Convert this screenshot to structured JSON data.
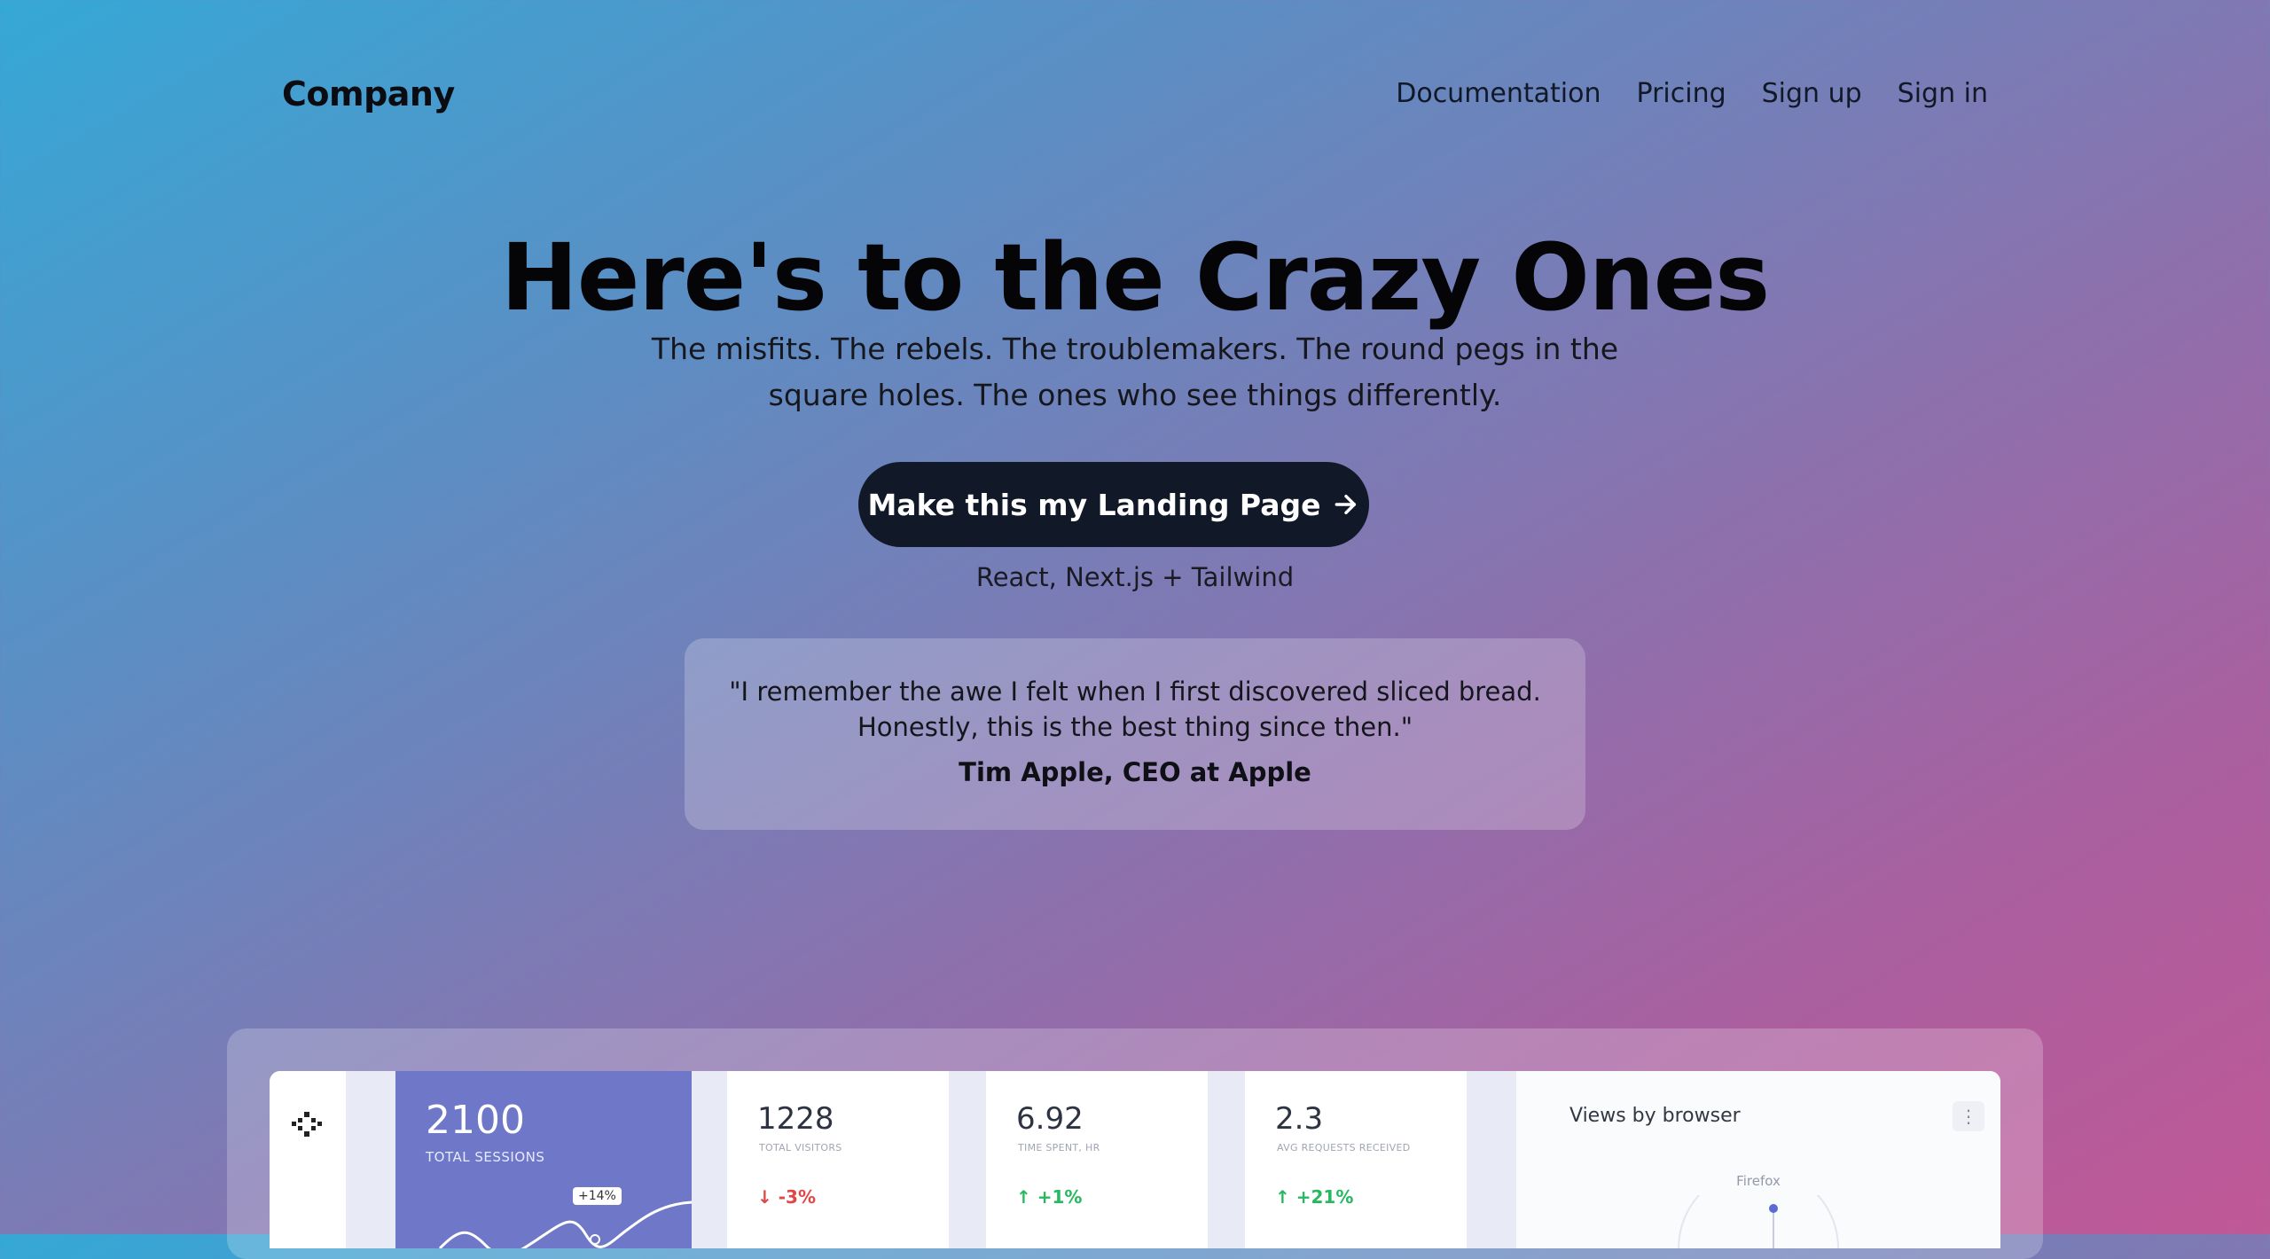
{
  "header": {
    "logo": "Company",
    "nav": [
      "Documentation",
      "Pricing",
      "Sign up",
      "Sign in"
    ]
  },
  "hero": {
    "title": "Here's to the Crazy Ones",
    "subtitle": "The misfits. The rebels. The troublemakers. The round pegs in the square holes. The ones who see things differently.",
    "cta_label": "Make this my Landing Page",
    "stack": "React, Next.js + Tailwind"
  },
  "testimonial": {
    "quote": "\"I remember the awe I felt when I first discovered sliced bread. Honestly, this is the best thing since then.\"",
    "author": "Tim Apple, CEO at Apple"
  },
  "dashboard": {
    "sessions": {
      "value": "2100",
      "label": "TOTAL SESSIONS",
      "badge": "+14%"
    },
    "stats": [
      {
        "value": "1228",
        "label": "TOTAL VISITORS",
        "change": "-3%",
        "direction": "down",
        "arrow": "↓"
      },
      {
        "value": "6.92",
        "label": "TIME SPENT, HR",
        "change": "+1%",
        "direction": "up",
        "arrow": "↑"
      },
      {
        "value": "2.3",
        "label": "AVG REQUESTS RECEIVED",
        "change": "+21%",
        "direction": "up",
        "arrow": "↑"
      }
    ],
    "browser": {
      "title": "Views by browser",
      "visible_label": "Firefox"
    }
  },
  "colors": {
    "cta_bg": "#111827",
    "sessions_card": "#6f78c8",
    "down": "#e04848",
    "up": "#28b860"
  },
  "icons": [
    "arrow-right-icon",
    "dashboard-logo-icon",
    "arrow-down-icon",
    "arrow-up-icon",
    "more-vertical-icon"
  ]
}
